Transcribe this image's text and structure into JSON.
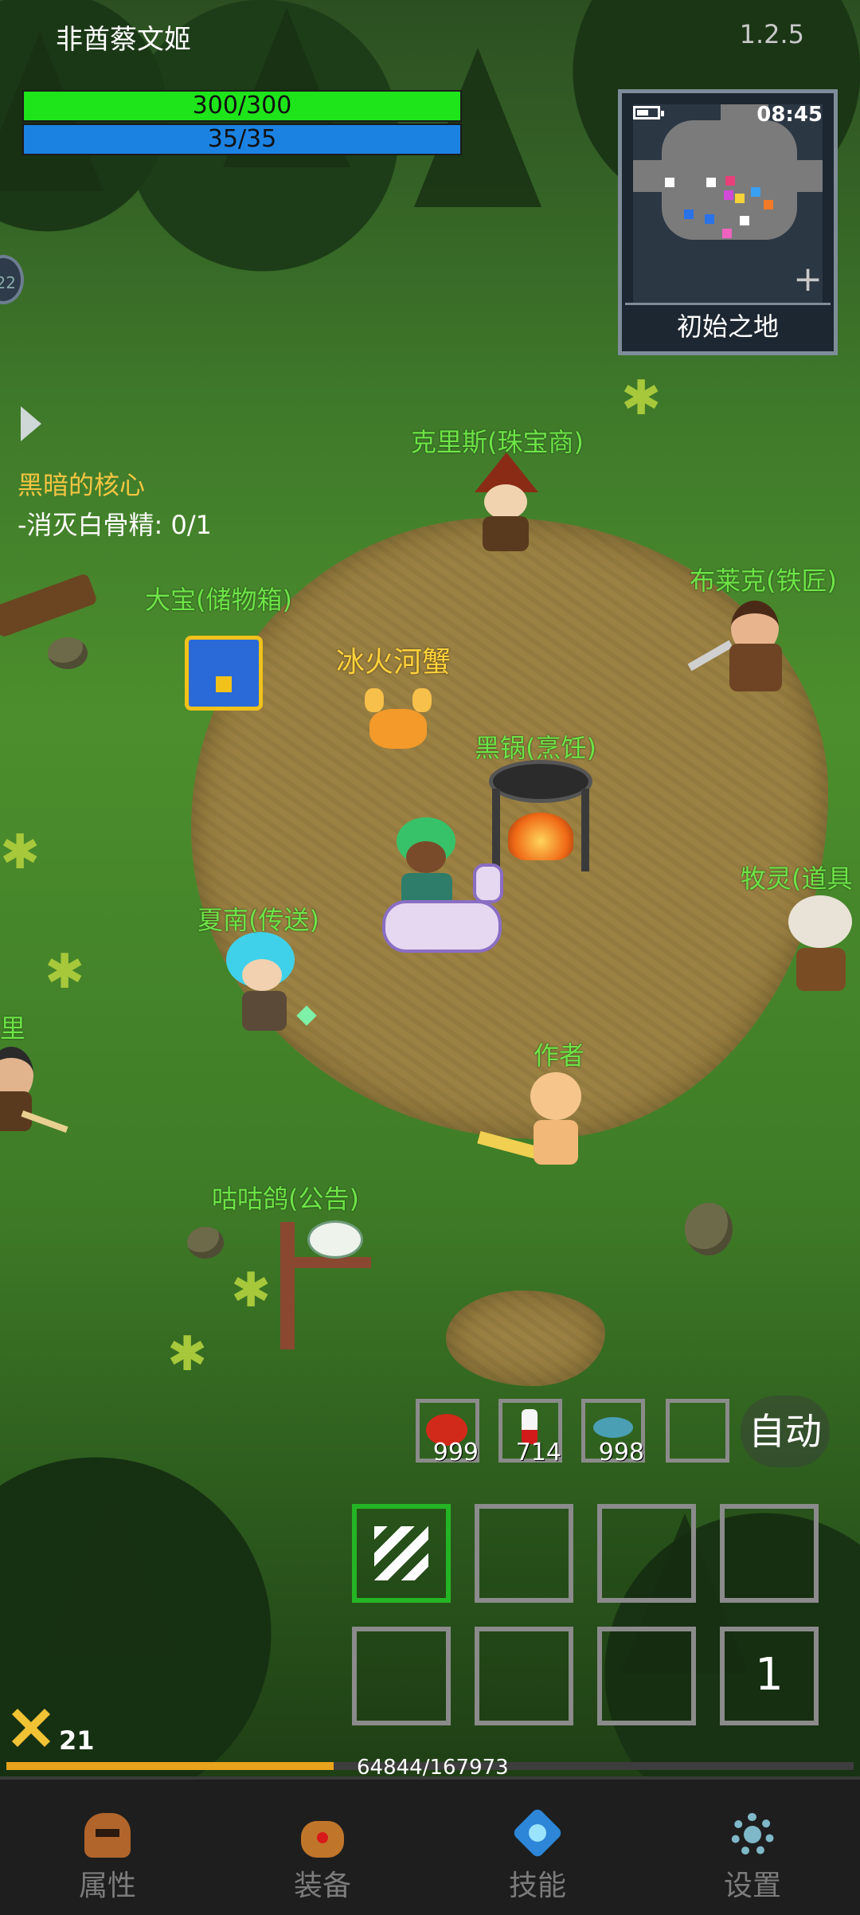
{
  "hud": {
    "player_name": "非酋蔡文姬",
    "version": "1.2.5",
    "hp_text": "300/300",
    "mp_text": "35/35",
    "hp_color": "#1ee51a",
    "mp_color": "#1b82e2"
  },
  "minimap": {
    "time": "08:45",
    "location": "初始之地",
    "expand_icon": "plus-icon",
    "battery_icon": "battery-icon"
  },
  "quest": {
    "title": "黑暗的核心",
    "task": "-消灭白骨精: 0/1"
  },
  "npcs": {
    "jeweler": "克里斯(珠宝商)",
    "storage": "大宝(储物箱)",
    "blacksmith": "布莱克(铁匠)",
    "cooking": "黑锅(烹饪)",
    "items": "牧灵(道具",
    "teleport": "夏南(传送)",
    "author": "作者",
    "announcement": "咕咕鸽(公告)",
    "edge_left": "里"
  },
  "monster": {
    "name": "冰火河蟹"
  },
  "quick_items": [
    {
      "icon": "meat-icon",
      "count": "999"
    },
    {
      "icon": "potion-icon",
      "count": "714"
    },
    {
      "icon": "fish-icon",
      "count": "998"
    },
    {
      "icon": "empty-slot",
      "count": ""
    }
  ],
  "auto_label": "自动",
  "skill_page": "1",
  "player": {
    "level": "21",
    "exp_text": "64844/167973",
    "exp_fraction": 0.386
  },
  "nav": [
    {
      "label": "属性",
      "icon": "helmet-icon"
    },
    {
      "label": "装备",
      "icon": "bag-icon"
    },
    {
      "label": "技能",
      "icon": "skill-gem-icon"
    },
    {
      "label": "设置",
      "icon": "gear-icon"
    }
  ]
}
